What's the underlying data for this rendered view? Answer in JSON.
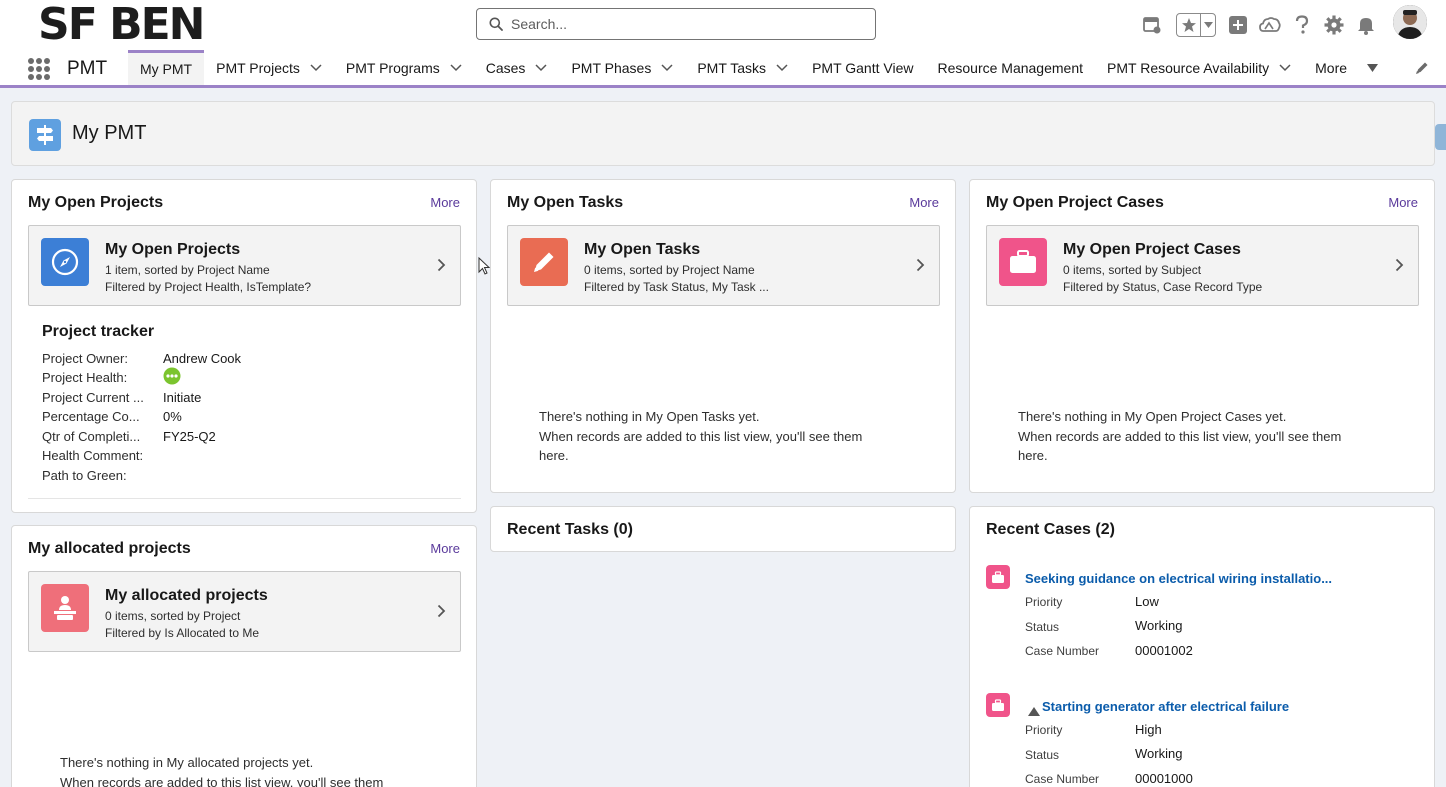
{
  "header": {
    "logo_text": "SF BEN",
    "search_placeholder": "Search..."
  },
  "nav": {
    "app_name": "PMT",
    "tabs": [
      {
        "label": "My PMT",
        "active": true,
        "dropdown": false
      },
      {
        "label": "PMT Projects",
        "dropdown": true
      },
      {
        "label": "PMT Programs",
        "dropdown": true
      },
      {
        "label": "Cases",
        "dropdown": true
      },
      {
        "label": "PMT Phases",
        "dropdown": true
      },
      {
        "label": "PMT Tasks",
        "dropdown": true
      },
      {
        "label": "PMT Gantt View",
        "dropdown": false
      },
      {
        "label": "Resource Management",
        "dropdown": false
      },
      {
        "label": "PMT Resource Availability",
        "dropdown": true
      },
      {
        "label": "More",
        "dropdown": true
      }
    ]
  },
  "page": {
    "title": "My PMT"
  },
  "open_projects": {
    "title": "My Open Projects",
    "more": "More",
    "tile_title": "My Open Projects",
    "tile_line1": "1 item, sorted by Project Name",
    "tile_line2": "Filtered by Project Health, IsTemplate?",
    "tracker": {
      "title": "Project tracker",
      "rows": [
        {
          "label": "Project Owner:",
          "value": "Andrew Cook"
        },
        {
          "label": "Project Health:",
          "value": ""
        },
        {
          "label": "Project Current ...",
          "value": "Initiate"
        },
        {
          "label": "Percentage Co...",
          "value": "0%"
        },
        {
          "label": "Qtr of Completi...",
          "value": "FY25-Q2"
        },
        {
          "label": "Health Comment:",
          "value": ""
        },
        {
          "label": "Path to Green:",
          "value": ""
        }
      ]
    }
  },
  "open_tasks": {
    "title": "My Open Tasks",
    "more": "More",
    "tile_title": "My Open Tasks",
    "tile_line1": "0 items, sorted by Project Name",
    "tile_line2": "Filtered by Task Status, My Task ...",
    "empty_line1": "There's nothing in My Open Tasks yet.",
    "empty_line2": "When records are added to this list view, you'll see them",
    "empty_line3": "here."
  },
  "open_cases": {
    "title": "My Open Project Cases",
    "more": "More",
    "tile_title": "My Open Project Cases",
    "tile_line1": "0 items, sorted by Subject",
    "tile_line2": "Filtered by Status, Case Record Type",
    "empty_line1": "There's nothing in My Open Project Cases yet.",
    "empty_line2": "When records are added to this list view, you'll see them",
    "empty_line3": "here."
  },
  "allocated": {
    "title": "My allocated projects",
    "more": "More",
    "tile_title": "My allocated projects",
    "tile_line1": "0 items, sorted by Project",
    "tile_line2": "Filtered by Is Allocated to Me",
    "empty_line1": "There's nothing in My allocated projects yet.",
    "empty_line2": "When records are added to this list view, you'll see them"
  },
  "recent_tasks": {
    "title": "Recent Tasks (0)"
  },
  "recent_cases": {
    "title": "Recent Cases (2)",
    "items": [
      {
        "subject": "Seeking guidance on electrical wiring installatio...",
        "priority_label": "Priority",
        "priority": "Low",
        "status_label": "Status",
        "status": "Working",
        "number_label": "Case Number",
        "number": "00001002"
      },
      {
        "subject": "Starting generator after electrical failure",
        "priority_label": "Priority",
        "priority": "High",
        "status_label": "Status",
        "status": "Working",
        "number_label": "Case Number",
        "number": "00001000"
      }
    ]
  },
  "colors": {
    "nav_accent": "#9b82c7",
    "projects_icon": "#3c7fd6",
    "tasks_icon": "#e96c53",
    "cases_icon": "#f0548a",
    "allocated_icon": "#ef6f7a",
    "link": "#0b5cab",
    "more_link": "#5a3a9b",
    "health_green": "#7bc42e"
  },
  "icons": {
    "search": "search-icon",
    "projects": "compass-icon",
    "tasks": "pencil-icon",
    "cases": "briefcase-icon",
    "allocated": "person-at-desk-icon"
  }
}
